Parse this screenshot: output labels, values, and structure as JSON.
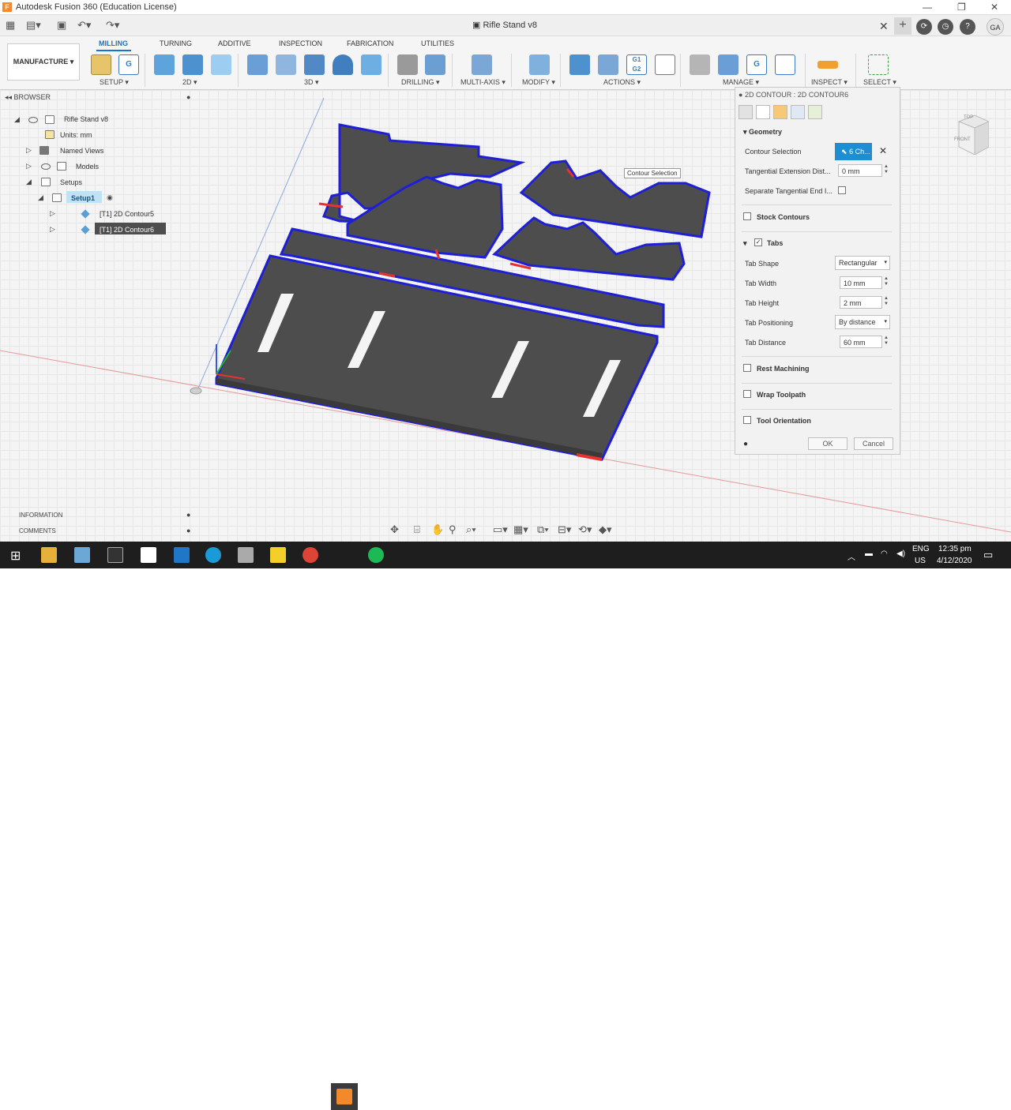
{
  "window": {
    "title": "Autodesk Fusion 360 (Education License)"
  },
  "document": {
    "tab_title": "Rifle Stand v8"
  },
  "user": {
    "initials": "GA"
  },
  "workspace": {
    "label": "MANUFACTURE ▾"
  },
  "ribbon": {
    "tabs": [
      "MILLING",
      "TURNING",
      "ADDITIVE",
      "INSPECTION",
      "FABRICATION",
      "UTILITIES"
    ],
    "groups": [
      "SETUP ▾",
      "2D ▾",
      "3D ▾",
      "DRILLING ▾",
      "MULTI-AXIS ▾",
      "MODIFY ▾",
      "ACTIONS ▾",
      "MANAGE ▾",
      "INSPECT ▾",
      "SELECT ▾"
    ]
  },
  "browser": {
    "header": "BROWSER",
    "root": "Rifle Stand v8",
    "units": "Units: mm",
    "named_views": "Named Views",
    "models": "Models",
    "setups": "Setups",
    "setup1": "Setup1",
    "op1": "[T1] 2D Contour5",
    "op2": "[T1] 2D Contour6"
  },
  "panel": {
    "header": "2D CONTOUR : 2D CONTOUR6",
    "geometry": "Geometry",
    "contour_selection_label": "Contour Selection",
    "contour_selection_value": "6 Ch...",
    "tangential_ext_label": "Tangential Extension Dist...",
    "tangential_ext_value": "0 mm",
    "separate_tangential_label": "Separate Tangential End I...",
    "stock_contours": "Stock Contours",
    "tabs": "Tabs",
    "tab_shape_label": "Tab Shape",
    "tab_shape_value": "Rectangular",
    "tab_width_label": "Tab Width",
    "tab_width_value": "10 mm",
    "tab_height_label": "Tab Height",
    "tab_height_value": "2 mm",
    "tab_positioning_label": "Tab Positioning",
    "tab_positioning_value": "By distance",
    "tab_distance_label": "Tab Distance",
    "tab_distance_value": "60 mm",
    "rest_machining": "Rest Machining",
    "wrap_toolpath": "Wrap Toolpath",
    "tool_orientation": "Tool Orientation",
    "ok": "OK",
    "cancel": "Cancel"
  },
  "tooltip": "Contour Selection",
  "info": {
    "information": "INFORMATION",
    "comments": "COMMENTS"
  },
  "viewcube": {
    "top": "TOP",
    "front": "FRONT"
  },
  "taskbar": {
    "lang1": "ENG",
    "lang2": "US",
    "time": "12:35 pm",
    "date": "4/12/2020"
  }
}
